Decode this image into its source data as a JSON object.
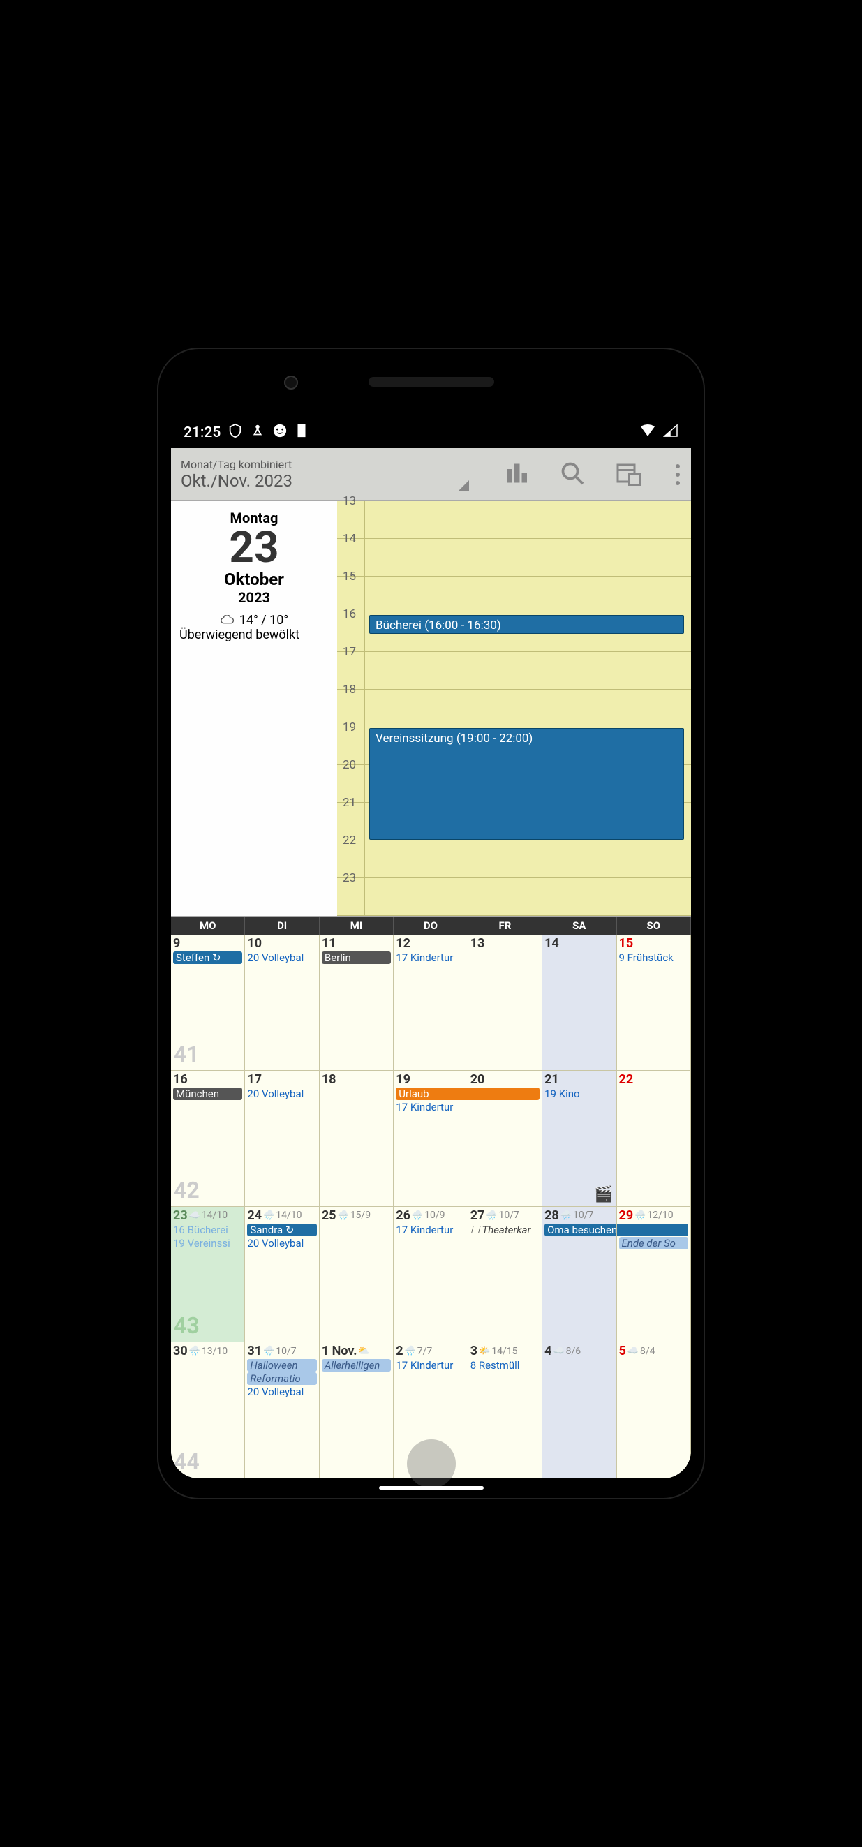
{
  "status": {
    "time": "21:25",
    "icons_right": [
      "wifi",
      "signal"
    ]
  },
  "toolbar": {
    "subtitle": "Monat/Tag kombiniert",
    "title": "Okt./Nov. 2023"
  },
  "day_panel": {
    "weekday": "Montag",
    "daynum": "23",
    "month": "Oktober",
    "year": "2023",
    "temp": "14° / 10°",
    "weather_desc": "Überwiegend bewölkt"
  },
  "hours": [
    "13",
    "14",
    "15",
    "16",
    "17",
    "18",
    "19",
    "20",
    "21",
    "22",
    "23"
  ],
  "day_events": {
    "e1": "Bücherei (16:00 - 16:30)",
    "e2": "Vereinssitzung (19:00 - 22:00)"
  },
  "weekdays": [
    "MO",
    "DI",
    "MI",
    "DO",
    "FR",
    "SA",
    "SO"
  ],
  "grid": {
    "r0": {
      "d0": {
        "num": "9",
        "wk": "41",
        "ev": {
          "a": "Steffen ↻"
        }
      },
      "d1": {
        "num": "10",
        "ev": {
          "a": "20 Volleybal"
        }
      },
      "d2": {
        "num": "11",
        "ev": {
          "a": "Berlin"
        }
      },
      "d3": {
        "num": "12",
        "ev": {
          "a": "17 Kindertur"
        }
      },
      "d4": {
        "num": "13"
      },
      "d5": {
        "num": "14"
      },
      "d6": {
        "num": "15",
        "ev": {
          "a": "9 Frühstück"
        }
      }
    },
    "r1": {
      "d0": {
        "num": "16",
        "wk": "42",
        "ev": {
          "a": "München"
        }
      },
      "d1": {
        "num": "17",
        "ev": {
          "a": "20 Volleybal"
        }
      },
      "d2": {
        "num": "18"
      },
      "d3": {
        "num": "19",
        "ev": {
          "a": "Urlaub",
          "b": "17 Kindertur"
        }
      },
      "d4": {
        "num": "20"
      },
      "d5": {
        "num": "21",
        "ev": {
          "a": "19 Kino"
        }
      },
      "d6": {
        "num": "22"
      }
    },
    "r2": {
      "d0": {
        "num": "23",
        "w": "14/10",
        "wk": "43",
        "ev": {
          "a": "16 Bücherei",
          "b": "19 Vereinssi"
        }
      },
      "d1": {
        "num": "24",
        "w": "14/10",
        "ev": {
          "a": "Sandra ↻",
          "b": "20 Volleybal"
        }
      },
      "d2": {
        "num": "25",
        "w": "15/9"
      },
      "d3": {
        "num": "26",
        "w": "10/9",
        "ev": {
          "a": "17 Kindertur"
        }
      },
      "d4": {
        "num": "27",
        "w": "10/7",
        "ev": {
          "a": "☐ Theaterkar"
        }
      },
      "d5": {
        "num": "28",
        "w": "10/7",
        "ev": {
          "a": "Oma besuchen"
        }
      },
      "d6": {
        "num": "29",
        "w": "12/10",
        "ev": {
          "b": "Ende der So"
        }
      }
    },
    "r3": {
      "d0": {
        "num": "30",
        "w": "13/10",
        "wk": "44"
      },
      "d1": {
        "num": "31",
        "w": "10/7",
        "ev": {
          "a": "Halloween",
          "b": "Reformatio",
          "c": "20 Volleybal"
        }
      },
      "d2": {
        "num": "1 Nov.",
        "w": "",
        "ev": {
          "a": "Allerheiligen"
        }
      },
      "d3": {
        "num": "2",
        "w": "7/7",
        "ev": {
          "a": "17 Kindertur"
        }
      },
      "d4": {
        "num": "3",
        "w": "14/15",
        "ev": {
          "a": "8 Restmüll"
        }
      },
      "d5": {
        "num": "4",
        "w": "8/6"
      },
      "d6": {
        "num": "5",
        "w": "8/4"
      }
    }
  }
}
